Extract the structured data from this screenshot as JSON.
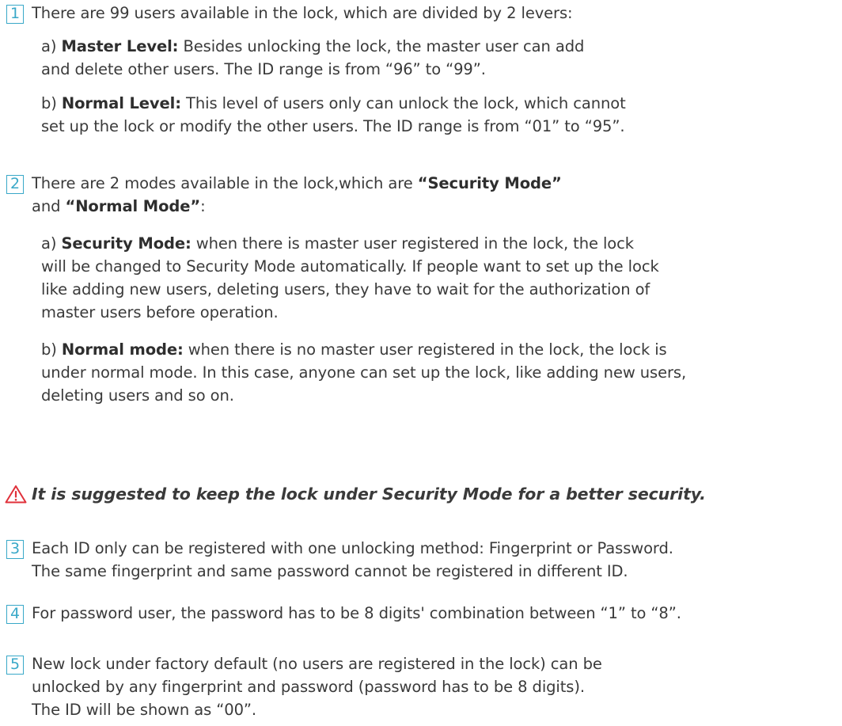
{
  "items": [
    {
      "number": "1",
      "text": "There are 99 users available in the lock, which are divided by 2 levers:",
      "sub": [
        {
          "prefix": "a) ",
          "bold": "Master Level:",
          "line1": " Besides unlocking the lock, the master user can add",
          "line2": "and delete other users. The ID range is from “96” to “99”."
        },
        {
          "prefix": "b) ",
          "bold": "Normal Level:",
          "line1": " This level of users only can unlock the lock, which cannot",
          "line2": "set up the lock or modify the other users. The ID range is from “01” to “95”."
        }
      ]
    },
    {
      "number": "2",
      "line1_text": "There are 2 modes available in the lock,which are ",
      "line1_bold": "“Security Mode”",
      "line2_prefix": "and ",
      "line2_bold": "“Normal Mode”",
      "line2_suffix": ":",
      "sub": [
        {
          "prefix": "a) ",
          "bold": "Security Mode:",
          "line1": " when there is master user registered in the lock, the lock",
          "line2": "will be changed to Security Mode automatically. If people want to set up the lock",
          "line3": "like adding new users, deleting users, they have to wait for the authorization of",
          "line4": "master users before operation."
        },
        {
          "prefix": "b) ",
          "bold": "Normal mode:",
          "line1": " when there is no master user registered in the lock, the lock is",
          "line2": "under normal mode. In this case, anyone can set up the lock, like adding new users,",
          "line3": "deleting users and so on."
        }
      ]
    },
    {
      "number": "3",
      "line1": "Each ID only can be registered with one unlocking method: Fingerprint or Password.",
      "line2": "The same fingerprint and same password cannot be registered in different ID."
    },
    {
      "number": "4",
      "line1": "For password user, the password has to be 8 digits' combination between “1” to “8”."
    },
    {
      "number": "5",
      "line1": "New lock under factory default (no users are registered in the lock) can be",
      "line2": "unlocked by any fingerprint and password (password has to be 8 digits).",
      "line3": "The ID will be shown as “00”."
    }
  ],
  "warning": {
    "icon": "warning-triangle-icon",
    "text": "It is suggested to keep the lock under Security Mode for a better security.",
    "color": "#e0303a"
  },
  "accent_color": "#39a8c8"
}
